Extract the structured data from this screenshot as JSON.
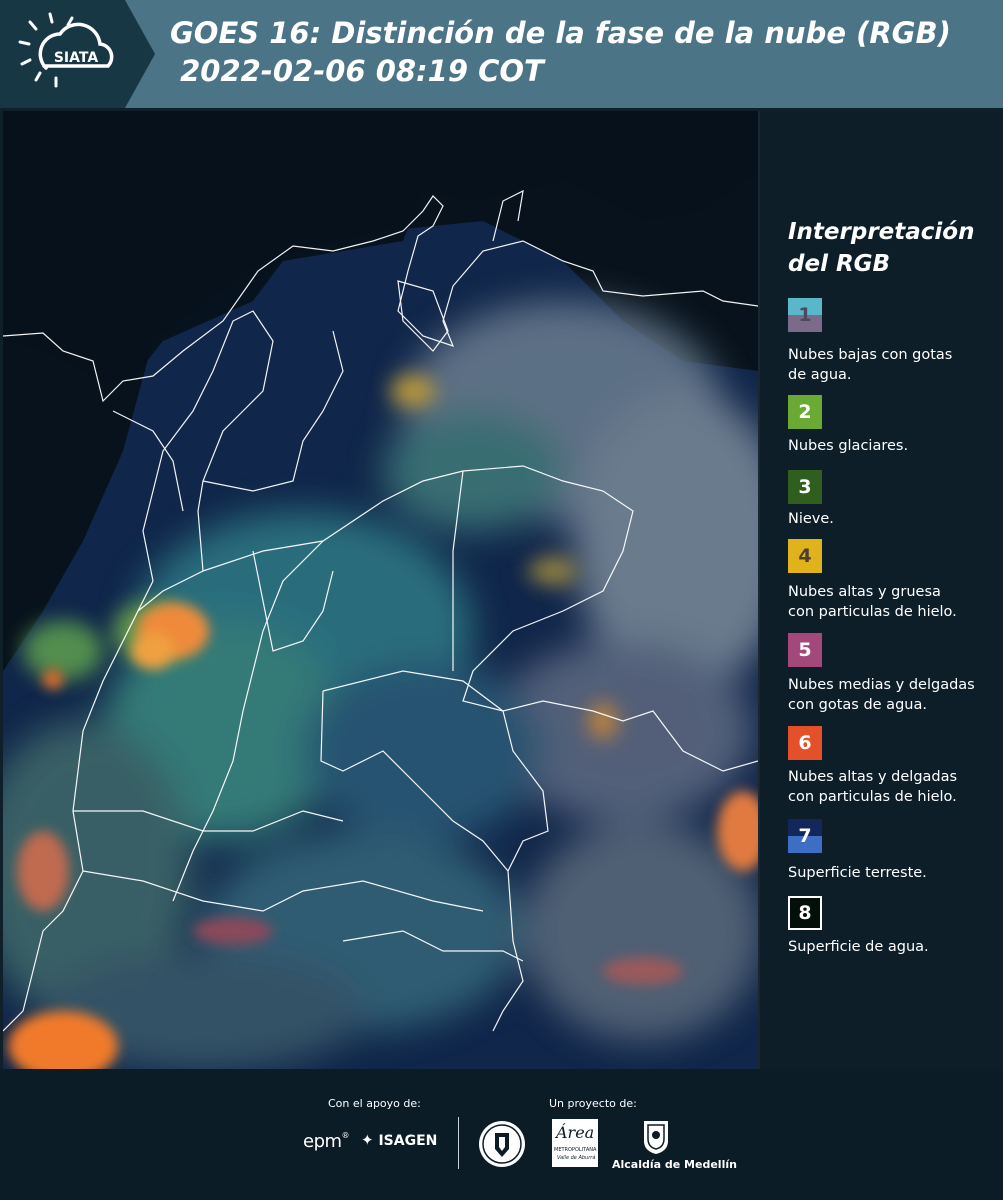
{
  "header": {
    "logo_text": "SIATA",
    "title": "GOES 16: Distinción de la fase de la nube (RGB)\n 2022-02-06 08:19 COT"
  },
  "legend": {
    "title": "Interpretación del RGB",
    "items": [
      {
        "number": "1",
        "label": "Nubes bajas con gotas\nde agua.",
        "colors": [
          "#5ab6c9",
          "#7b6a89"
        ],
        "text_color": "#4a4a5a"
      },
      {
        "number": "2",
        "label": "Nubes glaciares.",
        "colors": [
          "#6aaa34"
        ],
        "text_color": "#ffffff"
      },
      {
        "number": "3",
        "label": "Nieve.",
        "colors": [
          "#2f5e1e"
        ],
        "text_color": "#ffffff"
      },
      {
        "number": "4",
        "label": "Nubes altas y gruesa\ncon particulas de hielo.",
        "colors": [
          "#e0b21c"
        ],
        "text_color": "#4a4030"
      },
      {
        "number": "5",
        "label": "Nubes medias y delgadas\ncon gotas de agua.",
        "colors": [
          "#a2487a"
        ],
        "text_color": "#ffffff"
      },
      {
        "number": "6",
        "label": "Nubes altas y delgadas\ncon particulas de hielo.",
        "colors": [
          "#e4502a"
        ],
        "text_color": "#ffffff"
      },
      {
        "number": "7",
        "label": "Superficie terreste.",
        "colors": [
          "#13285a",
          "#3d6ec4"
        ],
        "text_color": "#ffffff"
      },
      {
        "number": "8",
        "label": "Superficie de agua.",
        "colors": [
          "#03100a"
        ],
        "text_color": "#ffffff"
      }
    ]
  },
  "footer": {
    "support_label": "Con el apoyo de:",
    "project_label": "Un proyecto de:",
    "sponsor_epm": "epm",
    "sponsor_isagen": "ISAGEN",
    "partner_metro": "Área",
    "partner_metro_sub": "METROPOLITANA",
    "partner_metro_sub2": "Valle de Aburrá",
    "partner_alcaldia": "Alcaldía de Medellín"
  }
}
